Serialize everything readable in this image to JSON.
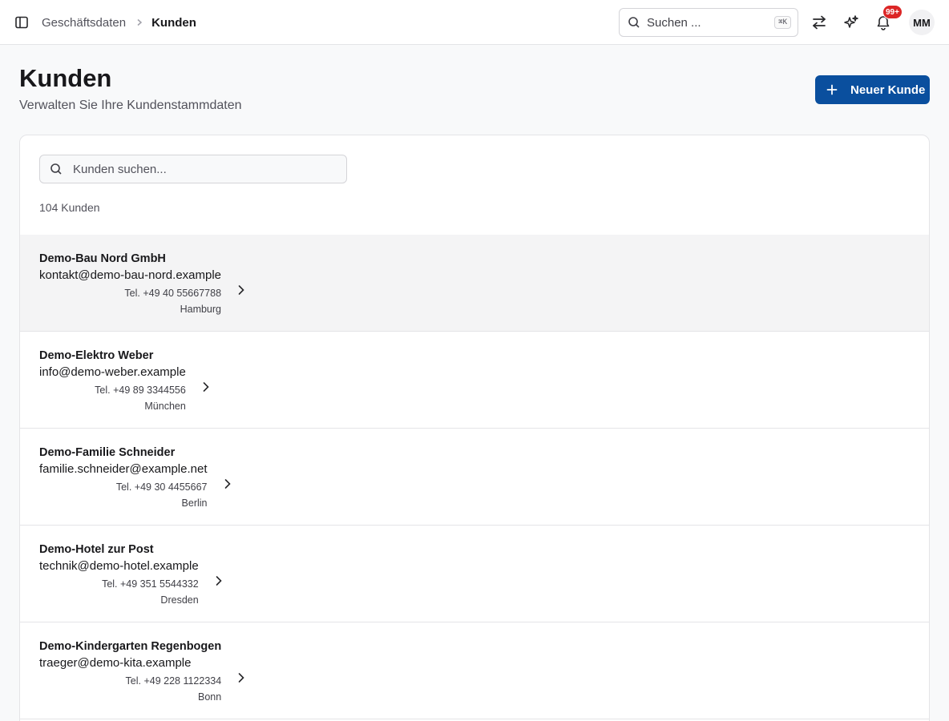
{
  "breadcrumb": {
    "parent": "Geschäftsdaten",
    "current": "Kunden"
  },
  "global_search": {
    "label": "Suchen ...",
    "shortcut": "⌘K"
  },
  "notifications": {
    "badge": "99+"
  },
  "user": {
    "initials": "MM"
  },
  "header": {
    "title": "Kunden",
    "subtitle": "Verwalten Sie Ihre Kundenstammdaten",
    "new_button_label": "Neuer Kunde"
  },
  "customer_search": {
    "placeholder": "Kunden suchen..."
  },
  "count_label": "104 Kunden",
  "colors": {
    "accent": "#0a4f9e",
    "badge": "#dc2626"
  },
  "customers": [
    {
      "name": "Demo-Bau Nord GmbH",
      "email": "kontakt@demo-bau-nord.example",
      "phone": "Tel. +49 40 55667788",
      "city": "Hamburg"
    },
    {
      "name": "Demo-Elektro Weber",
      "email": "info@demo-weber.example",
      "phone": "Tel. +49 89 3344556",
      "city": "München"
    },
    {
      "name": "Demo-Familie Schneider",
      "email": "familie.schneider@example.net",
      "phone": "Tel. +49 30 4455667",
      "city": "Berlin"
    },
    {
      "name": "Demo-Hotel zur Post",
      "email": "technik@demo-hotel.example",
      "phone": "Tel. +49 351 5544332",
      "city": "Dresden"
    },
    {
      "name": "Demo-Kindergarten Regenbogen",
      "email": "traeger@demo-kita.example",
      "phone": "Tel. +49 228 1122334",
      "city": "Bonn"
    }
  ]
}
